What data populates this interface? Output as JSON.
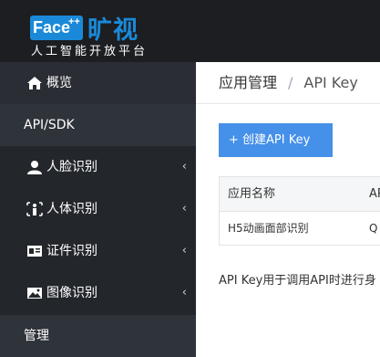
{
  "logo": {
    "brand": "Face",
    "sup": "++",
    "cn": "旷视",
    "tagline": "人工智能开放平台"
  },
  "sidebar": {
    "items": [
      {
        "label": "概览",
        "icon": "home-icon"
      },
      {
        "label": "API/SDK"
      },
      {
        "label": "人脸识别",
        "icon": "user-icon",
        "chevron": "‹"
      },
      {
        "label": "人体识别",
        "icon": "body-scan-icon",
        "chevron": "‹"
      },
      {
        "label": "证件识别",
        "icon": "id-card-icon",
        "chevron": "‹"
      },
      {
        "label": "图像识别",
        "icon": "image-icon",
        "chevron": "‹"
      },
      {
        "label": "管理"
      }
    ]
  },
  "breadcrumb": {
    "parent": "应用管理",
    "separator": "/",
    "current": "API Key"
  },
  "create_button": {
    "label": "+ 创建API Key"
  },
  "table": {
    "headers": [
      "应用名称",
      "AP"
    ],
    "rows": [
      [
        "H5动画面部识别",
        "Q"
      ]
    ]
  },
  "note": "API Key用于调用API时进行身",
  "colors": {
    "topbar": "#1c1e22",
    "sidebar": "#23262b",
    "accent": "#4590e9",
    "brand": "#1a8ad8"
  }
}
